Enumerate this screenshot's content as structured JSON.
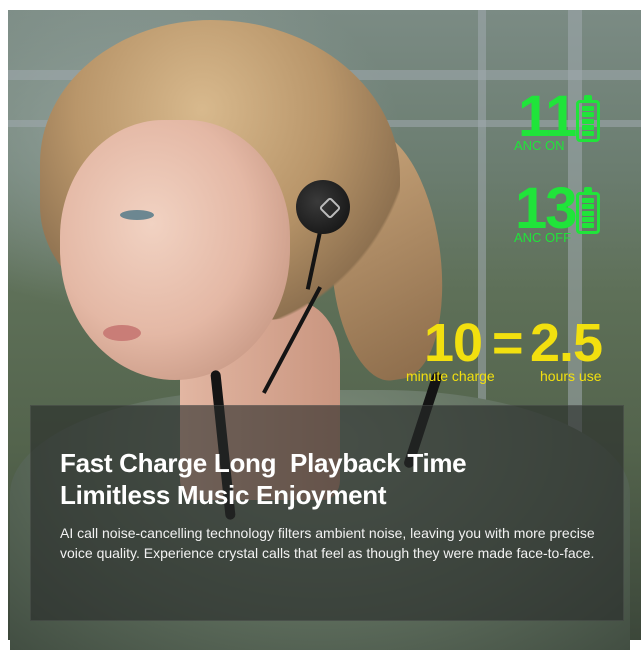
{
  "stats": {
    "anc_on_hours": "11",
    "anc_on_label": "ANC ON",
    "anc_off_hours": "13",
    "anc_off_label": "ANC OFF",
    "green_color": "#20e43a"
  },
  "fast_charge": {
    "minutes": "10",
    "equals": "=",
    "hours": "2.5",
    "minutes_label": "minute charge",
    "hours_label": "hours use",
    "yellow_color": "#f2e00f"
  },
  "headline": {
    "line1": "Fast Charge Long  Playback Time",
    "line2": "Limitless Music Enjoyment"
  },
  "body_text": "AI call noise-cancelling technology filters ambient noise, leaving you with more precise voice quality. Experience crystal calls that feel as though they were made face-to-face.",
  "icons": {
    "battery": "battery-full-icon"
  }
}
